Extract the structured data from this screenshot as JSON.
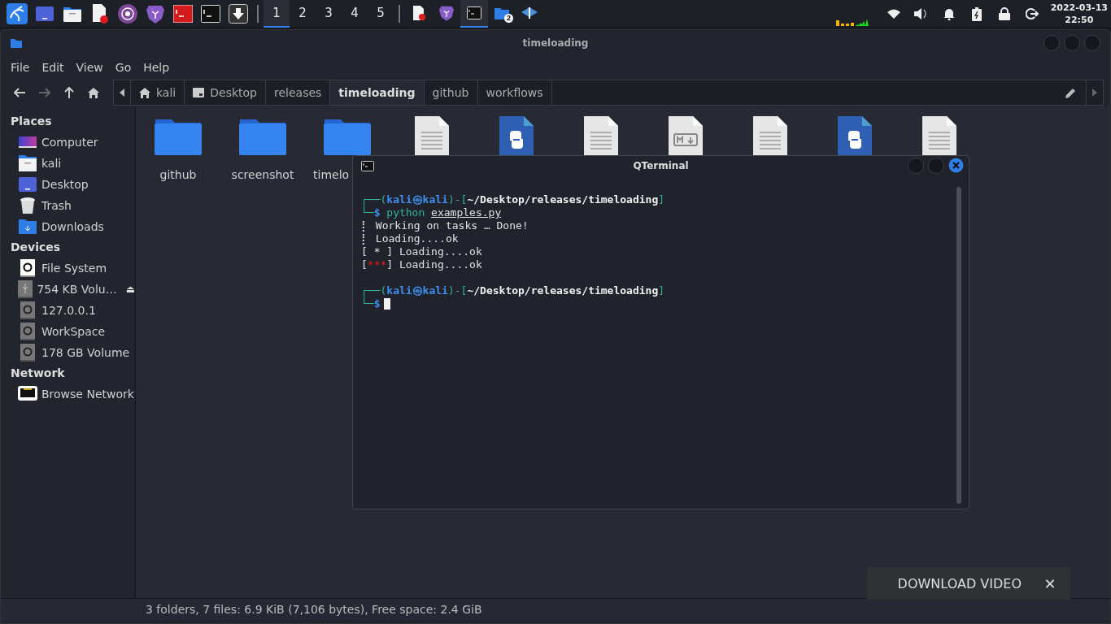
{
  "taskbar": {
    "launchers": [
      {
        "kind": "kali"
      },
      {
        "kind": "desktop"
      },
      {
        "kind": "files"
      },
      {
        "kind": "editor"
      },
      {
        "kind": "tor"
      },
      {
        "kind": "brave"
      },
      {
        "kind": "root-terminal"
      },
      {
        "kind": "terminal"
      },
      {
        "kind": "download"
      }
    ],
    "workspaces": [
      {
        "label": "1",
        "selected": true
      },
      {
        "label": "2",
        "selected": false
      },
      {
        "label": "3",
        "selected": false
      },
      {
        "label": "4",
        "selected": false
      },
      {
        "label": "5",
        "selected": false
      }
    ],
    "tasks": [
      {
        "kind": "editor",
        "selected": false
      },
      {
        "kind": "brave",
        "selected": false
      },
      {
        "kind": "terminal",
        "selected": true
      },
      {
        "kind": "files",
        "selected": false,
        "badge": "2"
      },
      {
        "kind": "network",
        "selected": false
      }
    ],
    "tray": [
      {
        "kind": "wifi"
      },
      {
        "kind": "volume"
      },
      {
        "kind": "bell"
      },
      {
        "kind": "battery"
      },
      {
        "kind": "lock"
      },
      {
        "kind": "logout"
      }
    ],
    "clock": {
      "date": "2022-03-13",
      "time": "22:50"
    }
  },
  "window": {
    "title": "timeloading"
  },
  "menu": [
    "File",
    "Edit",
    "View",
    "Go",
    "Help"
  ],
  "path": [
    {
      "label": "kali",
      "kind": "home",
      "selected": false
    },
    {
      "label": "Desktop",
      "kind": "desktop",
      "selected": false
    },
    {
      "label": "releases",
      "selected": false
    },
    {
      "label": "timeloading",
      "selected": true
    },
    {
      "label": "github",
      "selected": false
    },
    {
      "label": "workflows",
      "selected": false
    }
  ],
  "sidebar": [
    {
      "heading": "Places",
      "items": [
        {
          "label": "Computer",
          "kind": "computer"
        },
        {
          "label": "kali",
          "kind": "home"
        },
        {
          "label": "Desktop",
          "kind": "desktop"
        },
        {
          "label": "Trash",
          "kind": "trash"
        },
        {
          "label": "Downloads",
          "kind": "downloads"
        }
      ]
    },
    {
      "heading": "Devices",
      "items": [
        {
          "label": "File System",
          "kind": "hard-disk"
        },
        {
          "label": "754 KB Volu…",
          "kind": "usb",
          "eject": "⏏"
        },
        {
          "label": "127.0.0.1",
          "kind": "drive"
        },
        {
          "label": "WorkSpace",
          "kind": "drive"
        },
        {
          "label": "178 GB Volume",
          "kind": "drive"
        }
      ]
    },
    {
      "heading": "Network",
      "items": [
        {
          "label": "Browse Network",
          "kind": "network"
        }
      ]
    }
  ],
  "files": [
    {
      "name": "github",
      "kind": "folder"
    },
    {
      "name": "screenshot",
      "kind": "folder"
    },
    {
      "name": "timelo",
      "kind": "folder"
    },
    {
      "kind": "text"
    },
    {
      "kind": "python"
    },
    {
      "kind": "text"
    },
    {
      "kind": "markdown"
    },
    {
      "kind": "text"
    },
    {
      "kind": "python"
    },
    {
      "kind": "text"
    }
  ],
  "status_bar": "3 folders, 7 files: 6.9 KiB (7,106 bytes), Free space: 2.4 GiB",
  "terminal": {
    "title": "QTerminal",
    "lines": [
      {
        "kind": "prompt-top",
        "open": "┌──(",
        "user": "kali",
        "at": "㉿",
        "host": "kali",
        "mid": ")-[",
        "path": "~/Desktop/releases/timeloading",
        "close": "]"
      },
      {
        "kind": "prompt-bottom",
        "corner": "└─",
        "dollar": "$",
        "command": "python",
        "argument": "examples.py"
      },
      {
        "kind": "output",
        "text": "⡇ Working on tasks … Done!"
      },
      {
        "kind": "output",
        "text": "⡇ Loading....ok"
      },
      {
        "kind": "output",
        "text": "[ * ] Loading....ok"
      },
      {
        "kind": "marked",
        "open": "[",
        "marks": "***",
        "rest": "] Loading....ok",
        "color": "#e01b1b"
      },
      {
        "kind": "blank"
      },
      {
        "kind": "prompt-top",
        "open": "┌──(",
        "user": "kali",
        "at": "㉿",
        "host": "kali",
        "mid": ")-[",
        "path": "~/Desktop/releases/timeloading",
        "close": "]"
      },
      {
        "kind": "prompt-cursor",
        "corner": "└─",
        "dollar": "$"
      }
    ]
  },
  "overlay_button": {
    "label": "DOWNLOAD VIDEO",
    "close": "✕"
  }
}
